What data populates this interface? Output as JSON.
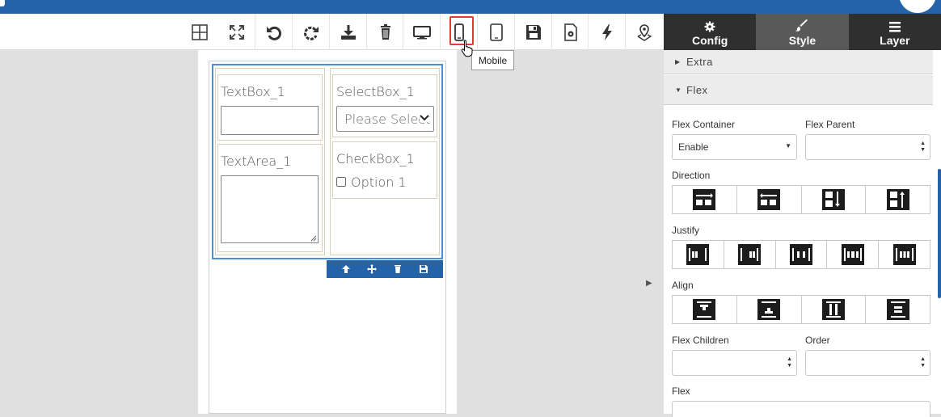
{
  "toolbar": {
    "buttons": [
      {
        "name": "grid-icon"
      },
      {
        "name": "fullscreen-icon"
      },
      {
        "name": "undo-icon"
      },
      {
        "name": "redo-icon"
      },
      {
        "name": "download-icon"
      },
      {
        "name": "trash-icon"
      },
      {
        "name": "desktop-icon"
      },
      {
        "name": "mobile-icon"
      },
      {
        "name": "tablet-icon"
      },
      {
        "name": "save-icon"
      },
      {
        "name": "settings-file-icon"
      },
      {
        "name": "lightning-icon"
      },
      {
        "name": "map-pin-icon"
      }
    ],
    "tooltip": "Mobile"
  },
  "form": {
    "textbox_label": "TextBox_1",
    "textarea_label": "TextArea_1",
    "selectbox_label": "SelectBox_1",
    "select_value": "Please Select",
    "checkbox_label": "CheckBox_1",
    "checkbox_option": "Option 1"
  },
  "panel": {
    "tabs": [
      {
        "label": "Config",
        "icon": "gear-icon"
      },
      {
        "label": "Style",
        "icon": "brush-icon"
      },
      {
        "label": "Layer",
        "icon": "bars-icon"
      }
    ],
    "active_tab": "Style",
    "sections": {
      "extra": "Extra",
      "flex": "Flex"
    },
    "flex_container_label": "Flex Container",
    "flex_container_value": "Enable",
    "flex_parent_label": "Flex Parent",
    "direction_label": "Direction",
    "justify_label": "Justify",
    "align_label": "Align",
    "flex_children_label": "Flex Children",
    "order_label": "Order",
    "flex_label": "Flex"
  },
  "colors": {
    "brand": "#2563a8",
    "highlight": "#e53935",
    "tab_active": "#595959",
    "tab": "#2f2f2f"
  }
}
